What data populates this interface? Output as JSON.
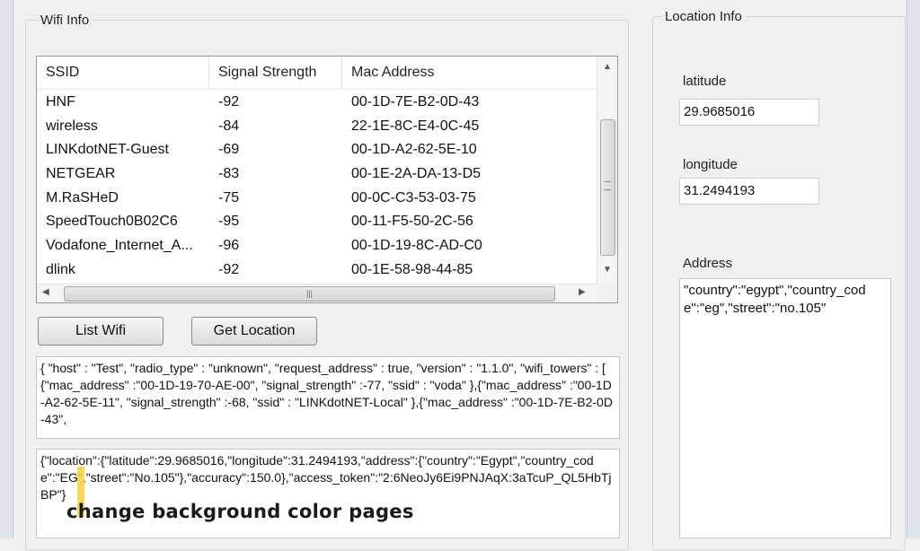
{
  "wifi_group": {
    "title": "Wifi Info",
    "columns": [
      "SSID",
      "Signal Strength",
      "Mac Address"
    ],
    "rows": [
      {
        "ssid": "HNF",
        "signal": "-92",
        "mac": "00-1D-7E-B2-0D-43"
      },
      {
        "ssid": "wireless",
        "signal": "-84",
        "mac": "22-1E-8C-E4-0C-45"
      },
      {
        "ssid": "LINKdotNET-Guest",
        "signal": "-69",
        "mac": "00-1D-A2-62-5E-10"
      },
      {
        "ssid": "NETGEAR",
        "signal": "-83",
        "mac": "00-1E-2A-DA-13-D5"
      },
      {
        "ssid": "M.RaSHeD",
        "signal": "-75",
        "mac": "00-0C-C3-53-03-75"
      },
      {
        "ssid": "SpeedTouch0B02C6",
        "signal": "-95",
        "mac": "00-11-F5-50-2C-56"
      },
      {
        "ssid": "Vodafone_Internet_A...",
        "signal": "-96",
        "mac": "00-1D-19-8C-AD-C0"
      },
      {
        "ssid": "dlink",
        "signal": "-92",
        "mac": "00-1E-58-98-44-85"
      }
    ],
    "buttons": {
      "list_wifi": "List Wifi",
      "get_location": "Get Location"
    },
    "request_text": "{ \"host\" : \"Test\", \"radio_type\" : \"unknown\", \"request_address\" : true, \"version\" : \"1.1.0\", \"wifi_towers\" : [ {\"mac_address\" :\"00-1D-19-70-AE-00\", \"signal_strength\" :-77, \"ssid\" : \"voda\" },{\"mac_address\" :\"00-1D-A2-62-5E-11\", \"signal_strength\" :-68, \"ssid\" : \"LINKdotNET-Local\" },{\"mac_address\" :\"00-1D-7E-B2-0D-43\",",
    "response_text": "{\"location\":{\"latitude\":29.9685016,\"longitude\":31.2494193,\"address\":{\"country\":\"Egypt\",\"country_code\":\"EG\",\"street\":\"No.105\"},\"accuracy\":150.0},\"access_token\":\"2:6NeoJy6Ei9PNJAqX:3aTcuP_QL5HbTjBP\"}"
  },
  "location_group": {
    "title": "Location Info",
    "latitude_label": "latitude",
    "latitude_value": "29.9685016",
    "longitude_label": "longitude",
    "longitude_value": "31.2494193",
    "address_label": "Address",
    "address_value": "\"country\":\"egypt\",\"country_code\":\"eg\",\"street\":\"no.105\""
  },
  "overlay": {
    "caption": "change background color pages",
    "marker_color": "#f4d43a"
  },
  "icons": [
    "scroll-up-arrow",
    "scroll-down-arrow",
    "scroll-left-arrow",
    "scroll-right-arrow",
    "scroll-grip"
  ]
}
